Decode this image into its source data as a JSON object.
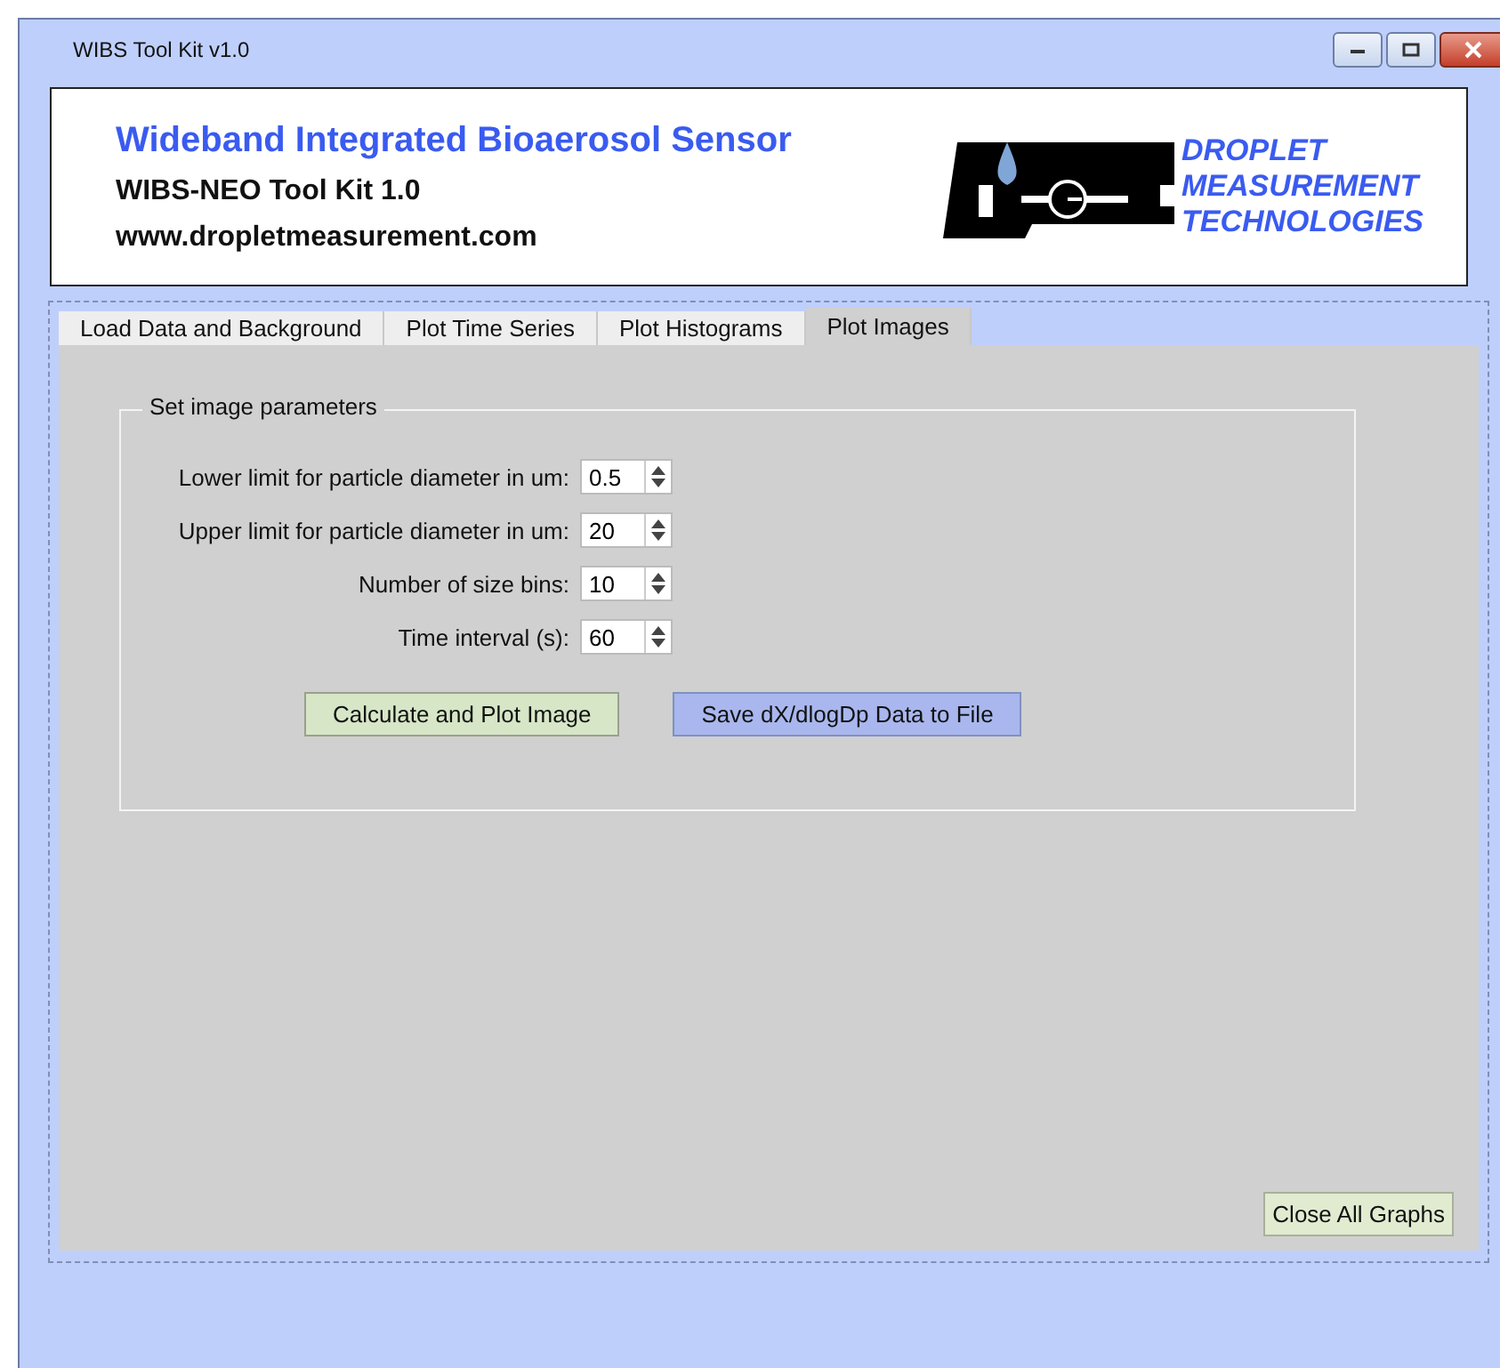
{
  "window": {
    "title": "WIBS Tool Kit v1.0"
  },
  "header": {
    "title": "Wideband Integrated Bioaerosol Sensor",
    "subtitle": "WIBS-NEO Tool Kit 1.0",
    "website": "www.dropletmeasurement.com",
    "logo_lines": [
      "DROPLET",
      "MEASUREMENT",
      "TECHNOLOGIES"
    ]
  },
  "tabs": [
    {
      "label": "Load Data and Background",
      "selected": false
    },
    {
      "label": "Plot Time Series",
      "selected": false
    },
    {
      "label": "Plot Histograms",
      "selected": false
    },
    {
      "label": "Plot Images",
      "selected": true
    }
  ],
  "group": {
    "title": "Set image parameters",
    "fields": [
      {
        "label": "Lower limit for particle diameter in um:",
        "value": "0.5"
      },
      {
        "label": "Upper limit for particle diameter in um:",
        "value": "20"
      },
      {
        "label": "Number of size bins:",
        "value": "10"
      },
      {
        "label": "Time interval (s):",
        "value": "60"
      }
    ],
    "buttons": [
      {
        "label": "Calculate and Plot Image",
        "kind": "green"
      },
      {
        "label": "Save dX/dlogDp Data to File",
        "kind": "blue"
      }
    ]
  },
  "close_button": "Close All Graphs"
}
